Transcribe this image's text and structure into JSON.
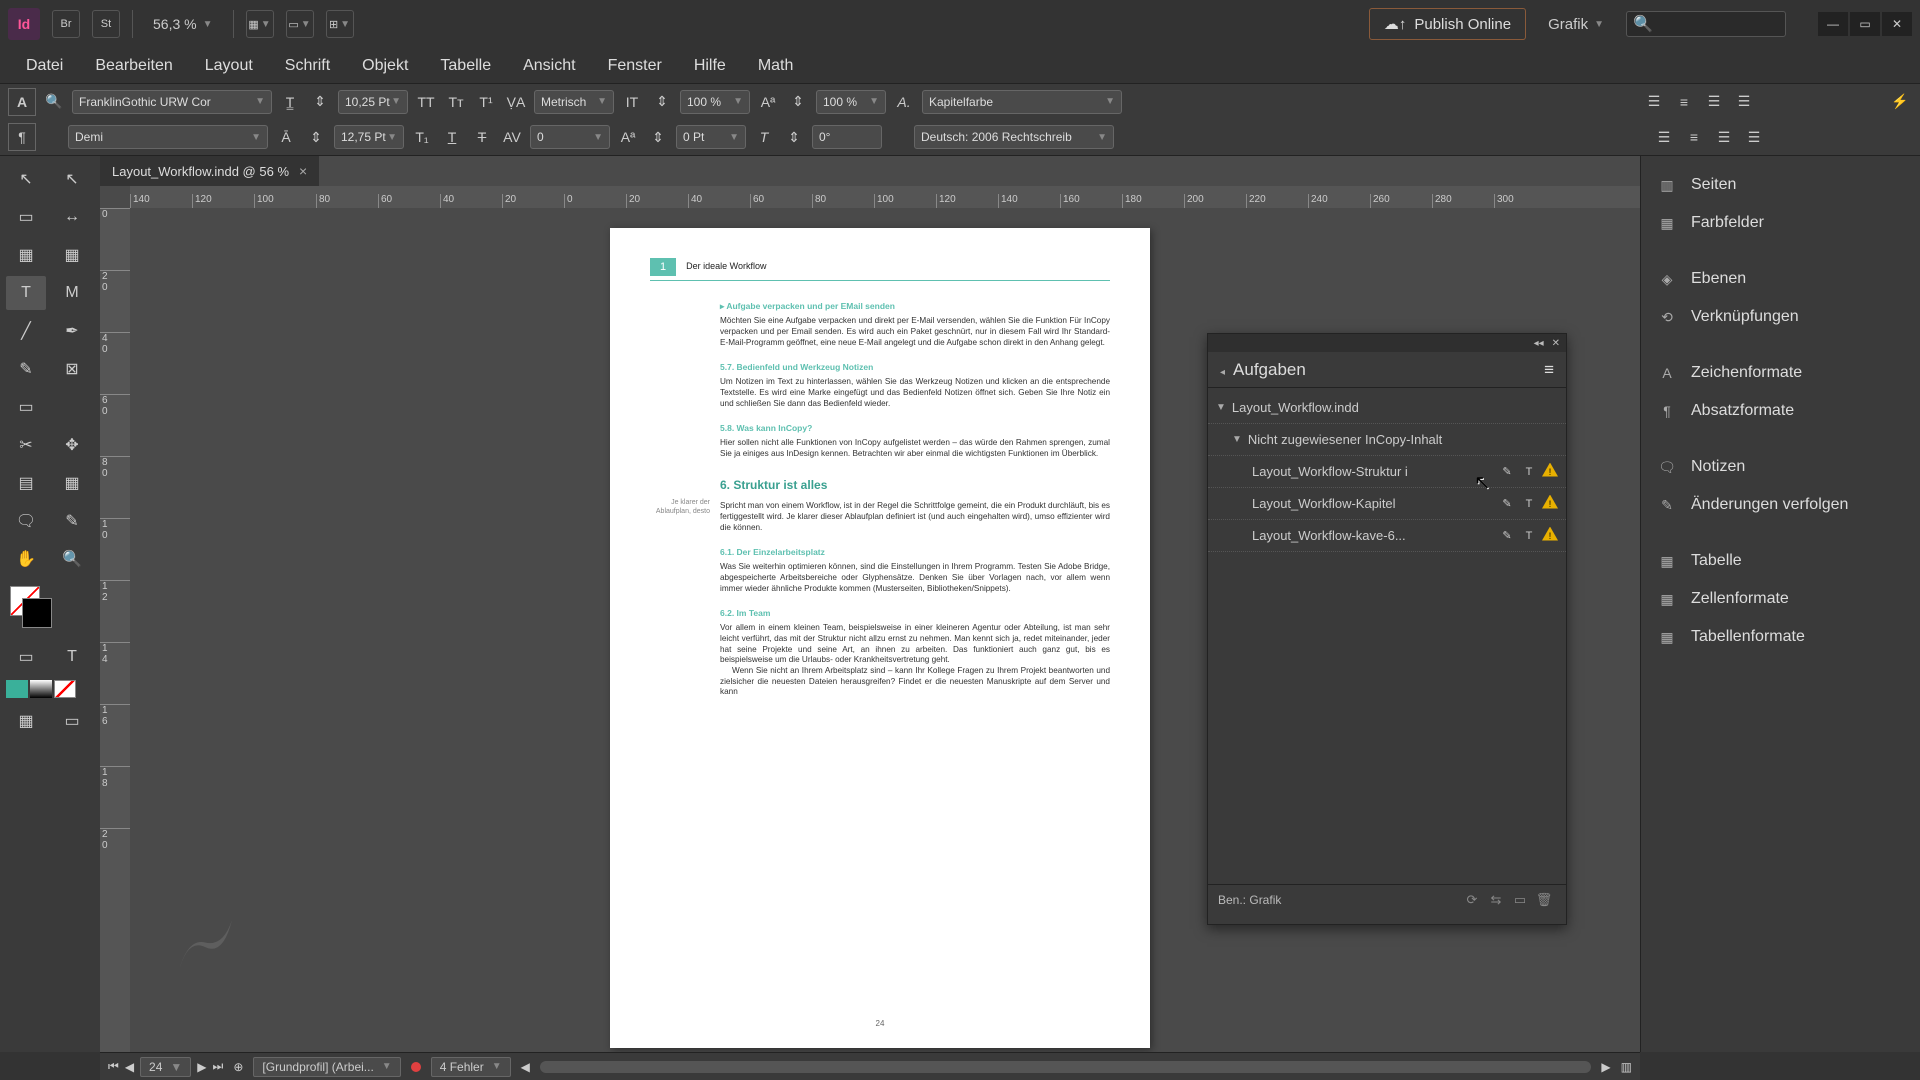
{
  "app_bar": {
    "br_icon": "Br",
    "st_icon": "St",
    "zoom": "56,3 %",
    "publish_label": "Publish Online",
    "workspace": "Grafik"
  },
  "menu": [
    "Datei",
    "Bearbeiten",
    "Layout",
    "Schrift",
    "Objekt",
    "Tabelle",
    "Ansicht",
    "Fenster",
    "Hilfe",
    "Math"
  ],
  "control": {
    "font": "FranklinGothic URW Cor",
    "weight": "Demi",
    "size": "10,25 Pt",
    "leading": "12,75 Pt",
    "metrics": "Metrisch",
    "tracking": "0",
    "scale_h": "100 %",
    "scale_v": "100 %",
    "baseline": "0 Pt",
    "skew": "0°",
    "char_style": "Kapitelfarbe",
    "language": "Deutsch: 2006 Rechtschreib"
  },
  "doc_tab": "Layout_Workflow.indd @ 56 %",
  "ruler_h": [
    "140",
    "120",
    "100",
    "80",
    "60",
    "40",
    "20",
    "0",
    "20",
    "40",
    "60",
    "80",
    "100",
    "120",
    "140",
    "160",
    "180",
    "200",
    "220",
    "240",
    "260",
    "280",
    "300"
  ],
  "ruler_v": [
    "0",
    "2",
    "4",
    "6",
    "8",
    "1",
    "1",
    "1",
    "1",
    "1",
    "2"
  ],
  "ruler_v_sub": [
    "",
    "0",
    "0",
    "0",
    "0",
    "0",
    "2",
    "4",
    "6",
    "8",
    "0"
  ],
  "page": {
    "chapter_num": "1",
    "chapter_title": "Der ideale Workflow",
    "sec1_h": "▸  Aufgabe verpacken und per EMail senden",
    "sec1_p": "Möchten Sie eine Aufgabe verpacken und direkt per E-Mail versenden, wählen Sie die Funktion Für InCopy verpacken und per Email senden. Es wird auch ein Paket geschnürt, nur in diesem Fall wird Ihr Standard-E-Mail-Programm geöffnet, eine neue E-Mail angelegt und die Aufgabe schon direkt in den Anhang gelegt.",
    "sec2_h": "5.7.   Bedienfeld und Werkzeug Notizen",
    "sec2_p": "Um Notizen im Text zu hinterlassen, wählen Sie das Werkzeug Notizen und klicken an die entsprechende Textstelle. Es wird eine Marke eingefügt und das Bedienfeld Notizen öffnet sich. Geben Sie Ihre Notiz ein und schließen Sie dann das Bedienfeld wieder.",
    "sec3_h": "5.8.   Was kann InCopy?",
    "sec3_marg1": "Je klarer der",
    "sec3_marg2": "Ablaufplan, desto",
    "sec3_p": "Hier sollen nicht alle Funktionen von InCopy aufgelistet werden – das würde den Rahmen sprengen, zumal Sie ja einiges aus InDesign kennen. Betrachten wir aber einmal die wichtigsten Funktionen im Überblick.",
    "sec4_h": "6.    Struktur ist alles",
    "sec4_p": "Spricht man von einem Workflow, ist in der Regel die Schrittfolge gemeint, die ein Produkt durchläuft, bis es fertiggestellt wird. Je klarer dieser Ablaufplan definiert ist (und auch eingehalten wird), umso effizienter wird die können.",
    "sec5_h": "6.1.   Der Einzelarbeitsplatz",
    "sec5_p": "Was Sie weiterhin optimieren können, sind die Einstellungen in Ihrem Programm. Testen Sie Adobe Bridge, abgespeicherte Arbeitsbereiche oder Glyphensätze. Denken Sie über Vorlagen nach, vor allem wenn immer wieder ähnliche Produkte kommen (Musterseiten, Bibliotheken/Snippets).",
    "sec6_h": "6.2.   Im Team",
    "sec6_p": "Vor allem in einem kleinen Team, beispielsweise in einer kleineren Agentur oder Abteilung, ist man sehr leicht verführt, das mit der Struktur nicht allzu ernst zu nehmen. Man kennt sich ja, redet miteinander, jeder hat seine Projekte und seine Art, an ihnen zu arbeiten. Das funktioniert auch ganz gut, bis es beispielsweise um die Urlaubs- oder Krankheitsvertretung geht.",
    "sec6_p2": "Wenn Sie nicht an Ihrem Arbeitsplatz sind – kann Ihr Kollege Fragen zu Ihrem Projekt beantworten und zielsicher die neuesten Dateien herausgreifen? Findet er die neuesten Manuskripte auf dem Server und kann",
    "page_num": "24"
  },
  "right_panels": [
    "Seiten",
    "Farbfelder",
    "Ebenen",
    "Verknüpfungen",
    "Zeichenformate",
    "Absatzformate",
    "Notizen",
    "Änderungen verfolgen",
    "Tabelle",
    "Zellenformate",
    "Tabellenformate"
  ],
  "aufgaben": {
    "title": "Aufgaben",
    "root": "Layout_Workflow.indd",
    "group": "Nicht zugewiesener InCopy-Inhalt",
    "items": [
      "Layout_Workflow-Struktur i",
      "Layout_Workflow-Kapitel",
      "Layout_Workflow-kave-6..."
    ],
    "footer_label": "Ben.: Grafik"
  },
  "status": {
    "page": "24",
    "profile": "[Grundprofil] (Arbei...",
    "errors": "4 Fehler"
  }
}
